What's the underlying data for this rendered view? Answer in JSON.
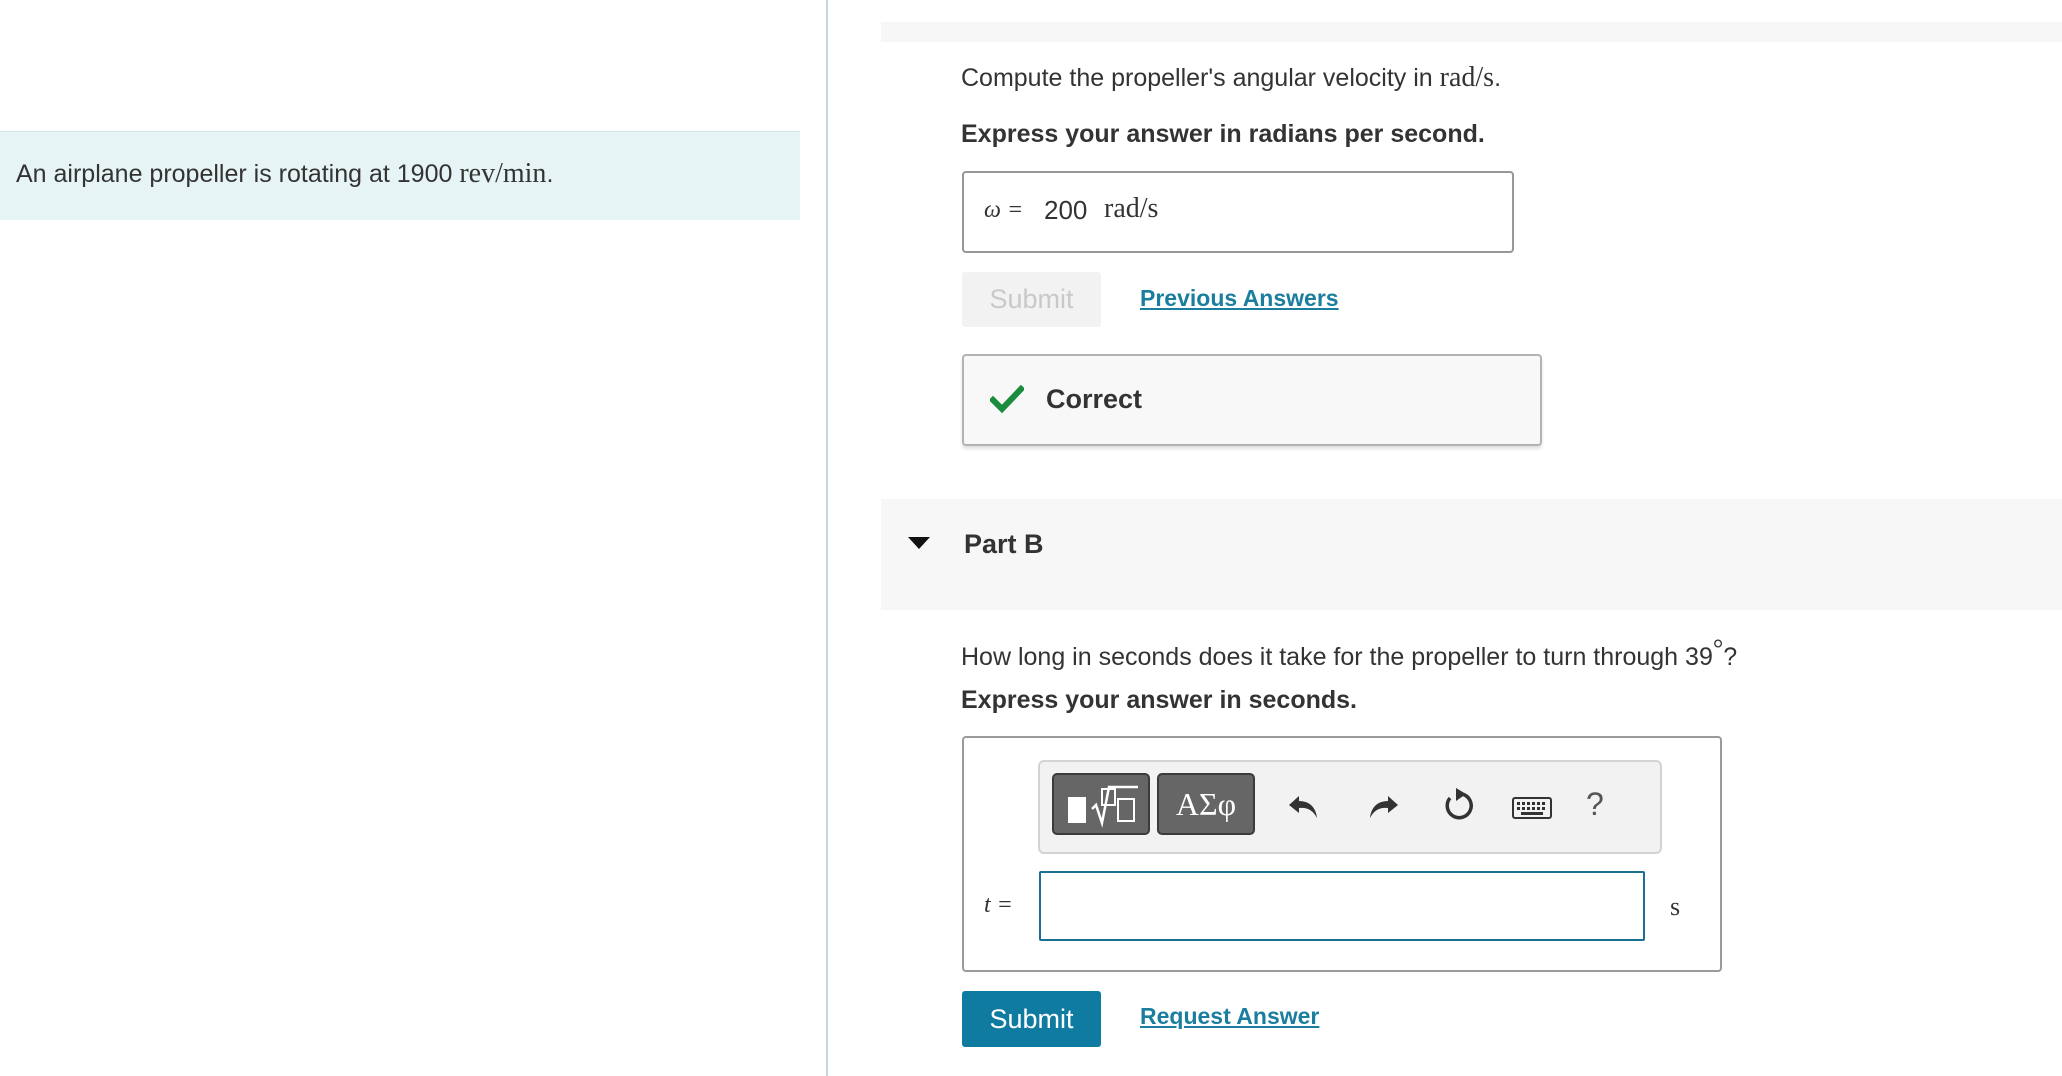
{
  "intro": {
    "text": "An airplane propeller is rotating at 1900 ",
    "unit": "rev/min",
    "period": "."
  },
  "part_a": {
    "question_text": "Compute the propeller's angular velocity in ",
    "question_unit": "rad/s",
    "question_period": ".",
    "instruction": "Express your answer in radians per second.",
    "answer_label": "ω =",
    "answer_value": "200",
    "answer_unit": "rad/s",
    "submit_label": "Submit",
    "previous_answers_label": "Previous Answers",
    "feedback": "Correct"
  },
  "part_b": {
    "title": "Part B",
    "question_text": "How long in seconds does it take for the propeller to turn through 39",
    "question_degree": "°",
    "question_mark": "?",
    "instruction": "Express your answer in seconds.",
    "toolbar": {
      "template_icon": "template-sqrt-icon",
      "greek_label": "ΑΣφ",
      "undo_icon": "undo-icon",
      "redo_icon": "redo-icon",
      "reset_icon": "reset-icon",
      "keyboard_icon": "keyboard-icon",
      "help_label": "?"
    },
    "answer_label": "t =",
    "answer_value": "",
    "answer_unit": "s",
    "submit_label": "Submit",
    "request_answer_label": "Request Answer"
  },
  "colors": {
    "intro_band": "#e6f4f5",
    "link": "#1b7e9e",
    "submit": "#0f7ba1",
    "check": "#1a8c3d"
  }
}
